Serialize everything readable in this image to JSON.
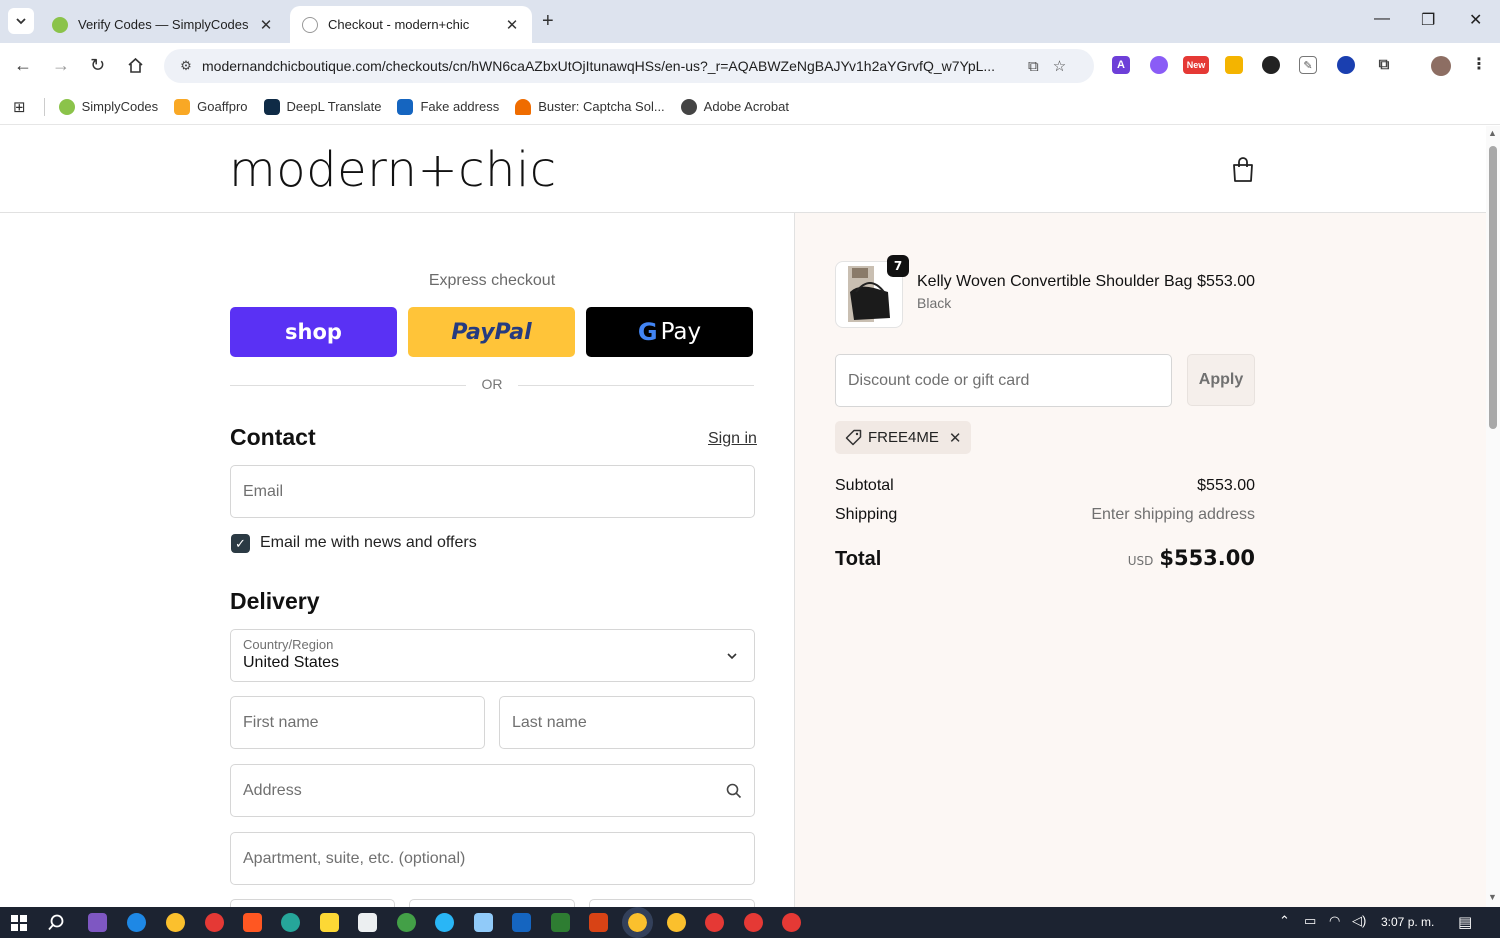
{
  "browser": {
    "tabs": [
      {
        "title": "Verify Codes — SimplyCodes",
        "active": false
      },
      {
        "title": "Checkout - modern+chic",
        "active": true
      }
    ],
    "url": "modernandchicboutique.com/checkouts/cn/hWN6caAZbxUtOjItunawqHSs/en-us?_r=AQABWZeNgBAJYv1h2aYGrvfQ_w7YpL...",
    "bookmarks": [
      "SimplyCodes",
      "Goaffpro",
      "DeepL Translate",
      "Fake address",
      "Buster: Captcha Sol...",
      "Adobe Acrobat"
    ],
    "ext_new_badge": "New"
  },
  "store": {
    "logo": "modern+chic"
  },
  "express": {
    "title": "Express checkout",
    "shop_label": "shop",
    "paypal_label": "PayPal",
    "gpay_label": "Pay",
    "or_label": "OR"
  },
  "contact": {
    "heading": "Contact",
    "signin": "Sign in",
    "email_placeholder": "Email",
    "news_checkbox": "Email me with news and offers"
  },
  "delivery": {
    "heading": "Delivery",
    "country_label": "Country/Region",
    "country_value": "United States",
    "first_name_placeholder": "First name",
    "last_name_placeholder": "Last name",
    "address_placeholder": "Address",
    "apartment_placeholder": "Apartment, suite, etc. (optional)"
  },
  "summary": {
    "product": {
      "name": "Kelly Woven Convertible Shoulder Bag",
      "variant": "Black",
      "price": "$553.00",
      "quantity": "7"
    },
    "discount_placeholder": "Discount code or gift card",
    "apply_label": "Apply",
    "applied_code": "FREE4ME",
    "subtotal_label": "Subtotal",
    "subtotal_value": "$553.00",
    "shipping_label": "Shipping",
    "shipping_value": "Enter shipping address",
    "total_label": "Total",
    "total_currency": "USD",
    "total_value": "$553.00"
  },
  "taskbar": {
    "time": "3:07 p. m."
  },
  "colors": {
    "shop_pay": "#5a31f4",
    "paypal": "#ffc439",
    "gpay": "#000000",
    "summary_bg": "#fcf7f4"
  }
}
